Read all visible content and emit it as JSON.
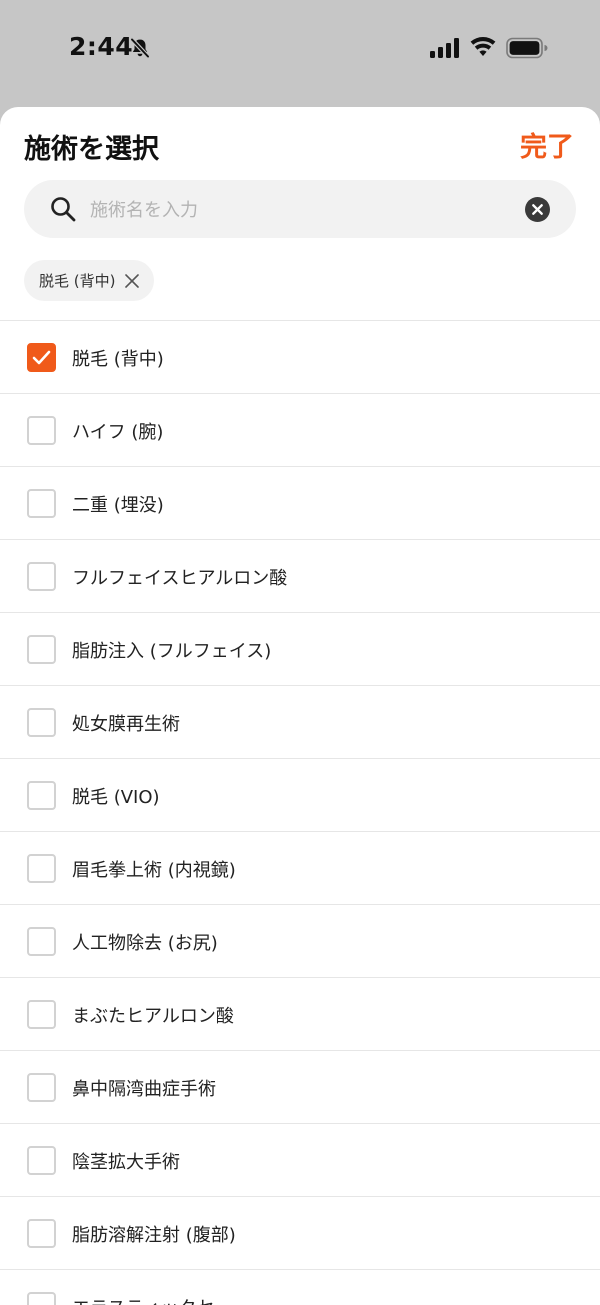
{
  "status_bar": {
    "time": "2:44"
  },
  "sheet": {
    "title": "施術を選択",
    "done_label": "完了"
  },
  "search": {
    "placeholder": "施術名を入力",
    "value": ""
  },
  "selected_chips": [
    {
      "label": "脱毛 (背中)"
    }
  ],
  "treatments": [
    {
      "label": "脱毛 (背中)",
      "checked": true
    },
    {
      "label": "ハイフ (腕)",
      "checked": false
    },
    {
      "label": "二重 (埋没)",
      "checked": false
    },
    {
      "label": "フルフェイスヒアルロン酸",
      "checked": false
    },
    {
      "label": "脂肪注入 (フルフェイス)",
      "checked": false
    },
    {
      "label": "処女膜再生術",
      "checked": false
    },
    {
      "label": "脱毛 (VIO)",
      "checked": false
    },
    {
      "label": "眉毛拳上術 (内視鏡)",
      "checked": false
    },
    {
      "label": "人工物除去 (お尻)",
      "checked": false
    },
    {
      "label": "まぶたヒアルロン酸",
      "checked": false
    },
    {
      "label": "鼻中隔湾曲症手術",
      "checked": false
    },
    {
      "label": "陰茎拡大手術",
      "checked": false
    },
    {
      "label": "脂肪溶解注射 (腹部)",
      "checked": false
    },
    {
      "label": "エラスティックセ",
      "checked": false
    }
  ],
  "colors": {
    "accent": "#f05a1a",
    "divider": "#e6e6e6",
    "search_bg": "#f2f2f2"
  },
  "icons": {
    "bell": "bell-slash-icon",
    "signal": "cellular-signal-icon",
    "wifi": "wifi-icon",
    "battery": "battery-icon",
    "search": "search-icon",
    "clear": "clear-circle-icon",
    "chip_remove": "close-icon",
    "check": "checkmark-icon"
  }
}
